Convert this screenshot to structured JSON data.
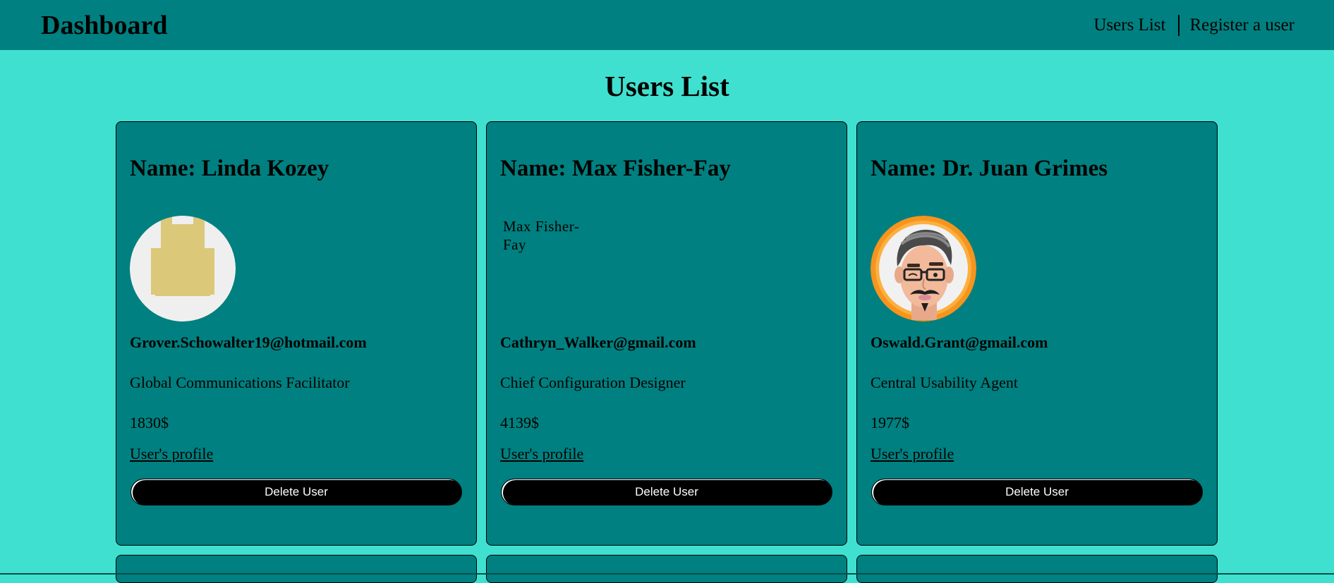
{
  "nav": {
    "brand": "Dashboard",
    "links": [
      "Users List",
      "Register a user"
    ]
  },
  "page": {
    "title": "Users List"
  },
  "users": [
    {
      "name": "Name: Linda Kozey",
      "email": "Grover.Schowalter19@hotmail.com",
      "job": "Global Communications Facilitator",
      "salary": "1830$",
      "profile_link": "User's profile",
      "delete_label": "Delete User",
      "avatar_icon": "abstract-avatar-icon"
    },
    {
      "name": "Name: Max Fisher-Fay",
      "email": "Cathryn_Walker@gmail.com",
      "job": "Chief Configuration Designer",
      "salary": "4139$",
      "profile_link": "User's profile",
      "delete_label": "Delete User",
      "avatar_alt": "Max Fisher-Fay"
    },
    {
      "name": "Name: Dr. Juan Grimes",
      "email": "Oswald.Grant@gmail.com",
      "job": "Central Usability Agent",
      "salary": "1977$",
      "profile_link": "User's profile",
      "delete_label": "Delete User",
      "avatar_icon": "cartoon-man-avatar-icon"
    }
  ],
  "colors": {
    "background": "#40e0d0",
    "navbar": "#008080",
    "card": "#008080",
    "button": "#000000"
  }
}
